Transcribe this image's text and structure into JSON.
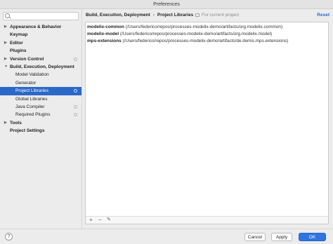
{
  "window": {
    "title": "Preferences"
  },
  "search": {
    "placeholder": "",
    "icon": "search-icon"
  },
  "tree": [
    {
      "label": "Appearance & Behavior",
      "bold": true,
      "arrow": "▶",
      "child": false,
      "gear": false,
      "selected": false
    },
    {
      "label": "Keymap",
      "bold": true,
      "arrow": "",
      "child": false,
      "gear": false,
      "selected": false
    },
    {
      "label": "Editor",
      "bold": true,
      "arrow": "▶",
      "child": false,
      "gear": false,
      "selected": false
    },
    {
      "label": "Plugins",
      "bold": true,
      "arrow": "",
      "child": false,
      "gear": false,
      "selected": false
    },
    {
      "label": "Version Control",
      "bold": true,
      "arrow": "▶",
      "child": false,
      "gear": true,
      "selected": false
    },
    {
      "label": "Build, Execution, Deployment",
      "bold": true,
      "arrow": "▼",
      "child": false,
      "gear": false,
      "selected": false
    },
    {
      "label": "Model Validation",
      "bold": false,
      "arrow": "",
      "child": true,
      "gear": false,
      "selected": false
    },
    {
      "label": "Generator",
      "bold": false,
      "arrow": "",
      "child": true,
      "gear": false,
      "selected": false
    },
    {
      "label": "Project Libraries",
      "bold": false,
      "arrow": "",
      "child": true,
      "gear": true,
      "selected": true
    },
    {
      "label": "Global Libraries",
      "bold": false,
      "arrow": "",
      "child": true,
      "gear": false,
      "selected": false
    },
    {
      "label": "Java Compiler",
      "bold": false,
      "arrow": "",
      "child": true,
      "gear": true,
      "selected": false
    },
    {
      "label": "Required Plugins",
      "bold": false,
      "arrow": "",
      "child": true,
      "gear": true,
      "selected": false
    },
    {
      "label": "Tools",
      "bold": true,
      "arrow": "▶",
      "child": false,
      "gear": false,
      "selected": false
    },
    {
      "label": "Project Settings",
      "bold": true,
      "arrow": "",
      "child": false,
      "gear": false,
      "selected": false
    }
  ],
  "breadcrumb": {
    "parent": "Build, Execution, Deployment",
    "separator": "›",
    "current": "Project Libraries"
  },
  "scope_label": "For current project",
  "reset_label": "Reset",
  "libraries": [
    {
      "name": "modelix-common",
      "path": "(/Users/federico/repos/processes-modelix-demo/artifacts/org.modelix.common)"
    },
    {
      "name": "modelix-model",
      "path": "(/Users/federico/repos/processes-modelix-demo/artifacts/org.modelix.model)"
    },
    {
      "name": "mps-extensions",
      "path": "(/Users/federico/repos/processes-modelix-demo/artifacts/de.itemis.mps.extensions)"
    }
  ],
  "panel_toolbar": {
    "add": "+",
    "remove": "−",
    "edit": "✎"
  },
  "footer": {
    "help": "?",
    "cancel": "Cancel",
    "apply": "Apply",
    "ok": "OK"
  },
  "colors": {
    "selection": "#2b68c7",
    "accent": "#2f74e2",
    "link": "#2b68c7"
  }
}
